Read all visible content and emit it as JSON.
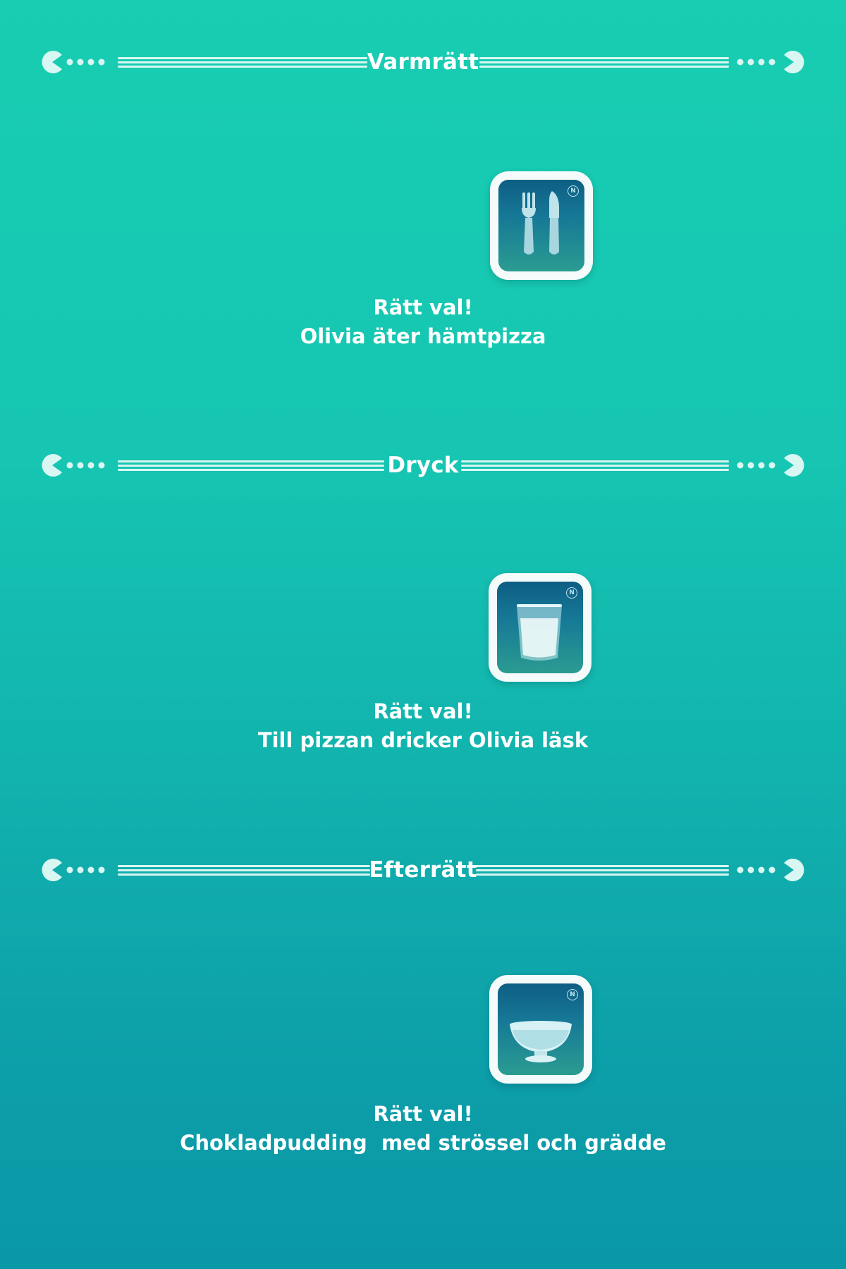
{
  "sections": [
    {
      "title": "Varmrätt",
      "icon": "cutlery-icon",
      "badge": "N",
      "result_title": "Rätt val!",
      "result_text": "Olivia äter hämtpizza"
    },
    {
      "title": "Dryck",
      "icon": "glass-icon",
      "badge": "N",
      "result_title": "Rätt val!",
      "result_text": "Till pizzan dricker Olivia läsk"
    },
    {
      "title": "Efterrätt",
      "icon": "dessert-bowl-icon",
      "badge": "N",
      "result_title": "Rätt val!",
      "result_text": "Chokladpudding  med strössel och grädde"
    }
  ],
  "colors": {
    "background_top": "#18cdb2",
    "background_bottom": "#0a98a7",
    "text": "#ffffff",
    "tile_frame": "#f4fbfa",
    "tile_inner_top": "#0e5e84",
    "tile_inner_bottom": "#2b9c91"
  }
}
